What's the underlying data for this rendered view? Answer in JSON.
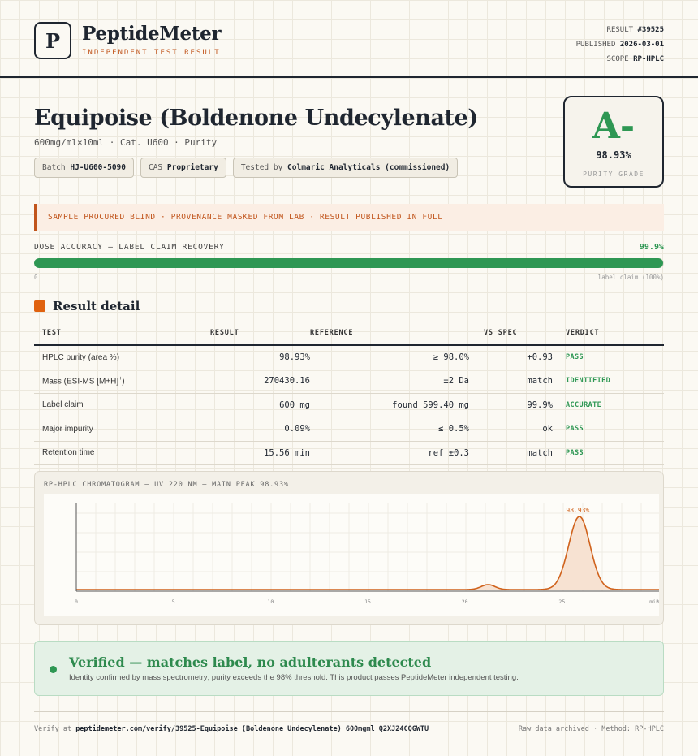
{
  "brand": {
    "logo_letter": "P",
    "name": "PeptideMeter",
    "tagline": "INDEPENDENT TEST RESULT"
  },
  "meta": {
    "result_label": "RESULT",
    "result_value": "#39525",
    "published_label": "PUBLISHED",
    "published_value": "2026-03-01",
    "scope_label": "SCOPE",
    "scope_value": "RP-HPLC"
  },
  "product": {
    "title": "Equipoise (Boldenone Undecylenate)",
    "subtitle": "600mg/ml×10ml · Cat. U600 · Purity",
    "chips": [
      {
        "label": "Batch",
        "value": "HJ-U600-5090"
      },
      {
        "label": "CAS",
        "value": "Proprietary"
      },
      {
        "label": "Tested by",
        "value": "Colmaric Analyticals (commissioned)"
      }
    ]
  },
  "grade": {
    "letter": "A-",
    "value": "98.93%",
    "label": "PURITY GRADE"
  },
  "notice": "SAMPLE PROCURED BLIND · PROVENANCE MASKED FROM LAB · RESULT PUBLISHED IN FULL",
  "dose": {
    "label": "DOSE ACCURACY — LABEL CLAIM RECOVERY",
    "value_text": "99.9%",
    "fraction": 0.999,
    "min_label": "0",
    "max_label": "label claim (100%)"
  },
  "section": {
    "title": "Result detail"
  },
  "table": {
    "headers": [
      "TEST",
      "RESULT",
      "REFERENCE",
      "VS SPEC",
      "VERDICT"
    ],
    "rows": [
      {
        "test": "HPLC purity (area %)",
        "result": "98.93%",
        "reference": "≥ 98.0%",
        "spec": "+0.93",
        "verdict": "PASS"
      },
      {
        "test": "Mass (ESI-MS [M+H]",
        "test_sup": "+",
        "test_end": ")",
        "result": "270430.16",
        "reference": "±2 Da",
        "spec": "match",
        "verdict": "IDENTIFIED"
      },
      {
        "test": "Label claim",
        "result": "600 mg",
        "reference": "found 599.40 mg",
        "spec": "99.9%",
        "verdict": "ACCURATE"
      },
      {
        "test": "Major impurity",
        "result": "0.09%",
        "reference": "≤ 0.5%",
        "spec": "ok",
        "verdict": "PASS"
      },
      {
        "test": "Retention time",
        "result": "15.56 min",
        "reference": "ref ±0.3",
        "spec": "match",
        "verdict": "PASS"
      }
    ]
  },
  "chart_data": {
    "type": "line",
    "title": "RP-HPLC CHROMATOGRAM — UV 220 NM — MAIN PEAK 98.93%",
    "xlabel": "",
    "ylabel": "",
    "x_ticks": [
      "0",
      "5",
      "10",
      "15",
      "20",
      "25",
      "30"
    ],
    "x_tick_suffix": "min",
    "xlim": [
      0,
      30
    ],
    "ylim": [
      0,
      1
    ],
    "peaks": [
      {
        "rt": 21.2,
        "height": 0.06,
        "width": 0.35
      },
      {
        "rt": 25.9,
        "height": 0.9,
        "width": 0.55,
        "label": "98.93%"
      }
    ],
    "baseline": 0.0,
    "line_color": "#d0621c",
    "fill_color": "#f7e2d2"
  },
  "verified": {
    "title": "Verified — matches label, no adulterants detected",
    "subtitle": "Identity confirmed by mass spectrometry; purity exceeds the 98% threshold. This product passes PeptideMeter independent testing."
  },
  "footer": {
    "verify_prefix": "Verify at",
    "verify_url": "peptidemeter.com/verify/39525-Equipoise_(Boldenone_Undecylenate)_600mgml_Q2XJ24CQGWTU",
    "right_text": "Raw data archived · Method: RP-HPLC"
  }
}
